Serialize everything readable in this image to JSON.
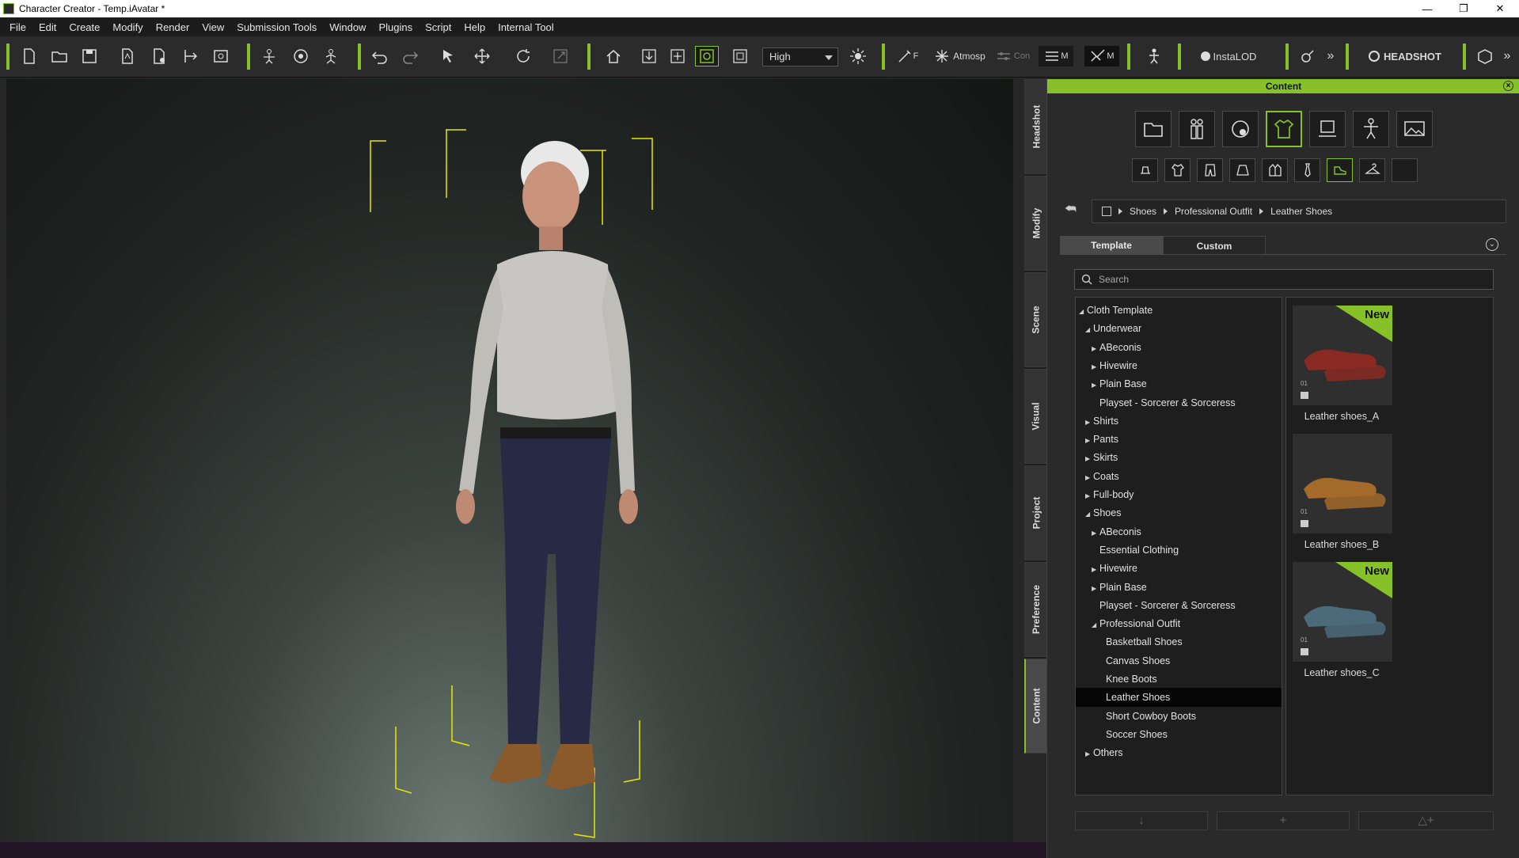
{
  "window": {
    "title": "Character Creator - Temp.iAvatar *"
  },
  "menu": [
    "File",
    "Edit",
    "Create",
    "Modify",
    "Render",
    "View",
    "Submission Tools",
    "Window",
    "Plugins",
    "Script",
    "Help",
    "Internal Tool"
  ],
  "toolbar": {
    "quality": "High",
    "atmosphere_label": "Atmosp",
    "con_label": "Con",
    "m_label": "M",
    "m2_label": "M",
    "f_label": "F",
    "instalod_label": "InstaLOD",
    "headshot_label": "HEADSHOT"
  },
  "side_tabs": [
    "Headshot",
    "Modify",
    "Scene",
    "Visual",
    "Project",
    "Preference",
    "Content"
  ],
  "panel": {
    "title": "Content",
    "breadcrumb": [
      "Shoes",
      "Professional Outfit",
      "Leather Shoes"
    ],
    "tabs": {
      "template": "Template",
      "custom": "Custom"
    },
    "search_placeholder": "Search"
  },
  "tree": [
    {
      "label": "Cloth Template",
      "level": 0,
      "state": "open"
    },
    {
      "label": "Underwear",
      "level": 1,
      "state": "open"
    },
    {
      "label": "ABeconis",
      "level": 2,
      "state": "closed"
    },
    {
      "label": "Hivewire",
      "level": 2,
      "state": "closed"
    },
    {
      "label": "Plain Base",
      "level": 2,
      "state": "closed"
    },
    {
      "label": "Playset - Sorcerer & Sorceress",
      "level": 2,
      "state": "leaf"
    },
    {
      "label": "Shirts",
      "level": 1,
      "state": "closed"
    },
    {
      "label": "Pants",
      "level": 1,
      "state": "closed"
    },
    {
      "label": "Skirts",
      "level": 1,
      "state": "closed"
    },
    {
      "label": "Coats",
      "level": 1,
      "state": "closed"
    },
    {
      "label": "Full-body",
      "level": 1,
      "state": "closed"
    },
    {
      "label": "Shoes",
      "level": 1,
      "state": "open"
    },
    {
      "label": "ABeconis",
      "level": 2,
      "state": "closed"
    },
    {
      "label": "Essential Clothing",
      "level": 2,
      "state": "leaf"
    },
    {
      "label": "Hivewire",
      "level": 2,
      "state": "closed"
    },
    {
      "label": "Plain Base",
      "level": 2,
      "state": "closed"
    },
    {
      "label": "Playset - Sorcerer & Sorceress",
      "level": 2,
      "state": "leaf"
    },
    {
      "label": "Professional Outfit",
      "level": 2,
      "state": "open"
    },
    {
      "label": "Basketball Shoes",
      "level": 3,
      "state": "leaf"
    },
    {
      "label": "Canvas Shoes",
      "level": 3,
      "state": "leaf"
    },
    {
      "label": "Knee Boots",
      "level": 3,
      "state": "leaf"
    },
    {
      "label": "Leather Shoes",
      "level": 3,
      "state": "leaf",
      "selected": true
    },
    {
      "label": "Short Cowboy Boots",
      "level": 3,
      "state": "leaf"
    },
    {
      "label": "Soccer Shoes",
      "level": 3,
      "state": "leaf"
    },
    {
      "label": "Others",
      "level": 1,
      "state": "closed"
    }
  ],
  "thumbnails": [
    {
      "label": "Leather shoes_A",
      "badge": "New",
      "num": "01",
      "color": "#8a2a22"
    },
    {
      "label": "Leather shoes_B",
      "badge": "",
      "num": "01",
      "color": "#a36a2a"
    },
    {
      "label": "Leather shoes_C",
      "badge": "New",
      "num": "01",
      "color": "#4b6a7a"
    }
  ],
  "colors": {
    "accent": "#86c12a",
    "panel_bg": "#2a2a2a",
    "tree_bg": "#1e1e1e"
  }
}
